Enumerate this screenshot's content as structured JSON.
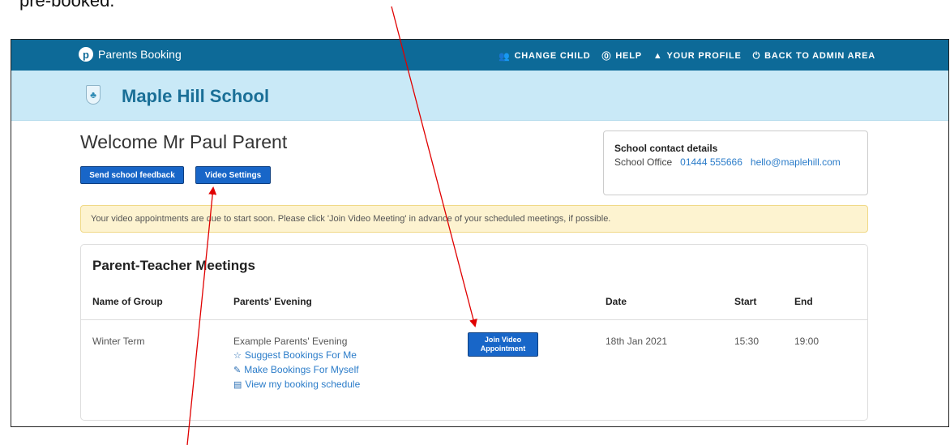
{
  "caption": "pre-booked.",
  "topbar": {
    "brand": "Parents Booking",
    "nav": [
      {
        "icon": "people-icon",
        "glyph": "👥",
        "label": "CHANGE CHILD"
      },
      {
        "icon": "help-icon",
        "glyph": "⓪",
        "label": "HELP"
      },
      {
        "icon": "user-icon",
        "glyph": "👤",
        "label": "YOUR PROFILE"
      },
      {
        "icon": "power-icon",
        "glyph": "⏻",
        "label": "BACK TO ADMIN AREA"
      }
    ]
  },
  "school": {
    "name": "Maple Hill School"
  },
  "welcome": "Welcome Mr Paul Parent",
  "buttons": {
    "feedback": "Send school feedback",
    "video_settings": "Video Settings"
  },
  "contact": {
    "title": "School contact details",
    "office": "School Office",
    "phone": "01444 555666",
    "email": "hello@maplehill.com"
  },
  "alert": "Your video appointments are due to start soon. Please click 'Join Video Meeting' in advance of your scheduled meetings, if possible.",
  "meetings": {
    "title": "Parent-Teacher Meetings",
    "headers": {
      "group": "Name of Group",
      "evening": "Parents' Evening",
      "date": "Date",
      "start": "Start",
      "end": "End"
    },
    "row": {
      "group": "Winter Term",
      "evening": "Example Parents' Evening",
      "join_button": "Join Video Appointment",
      "date": "18th Jan 2021",
      "start": "15:30",
      "end": "19:00",
      "actions": [
        {
          "icon": "star-icon",
          "glyph": "☆",
          "label": "Suggest Bookings For Me"
        },
        {
          "icon": "pencil-icon",
          "glyph": "✎",
          "label": "Make Bookings For Myself"
        },
        {
          "icon": "calendar-icon",
          "glyph": "▤",
          "label": "View my booking schedule"
        }
      ]
    }
  },
  "colors": {
    "topbar": "#0d6a98",
    "schoolbar": "#c9e9f7",
    "button": "#1866c8",
    "alert": "#fdf3d0",
    "annotation_arrow": "#e00000"
  }
}
